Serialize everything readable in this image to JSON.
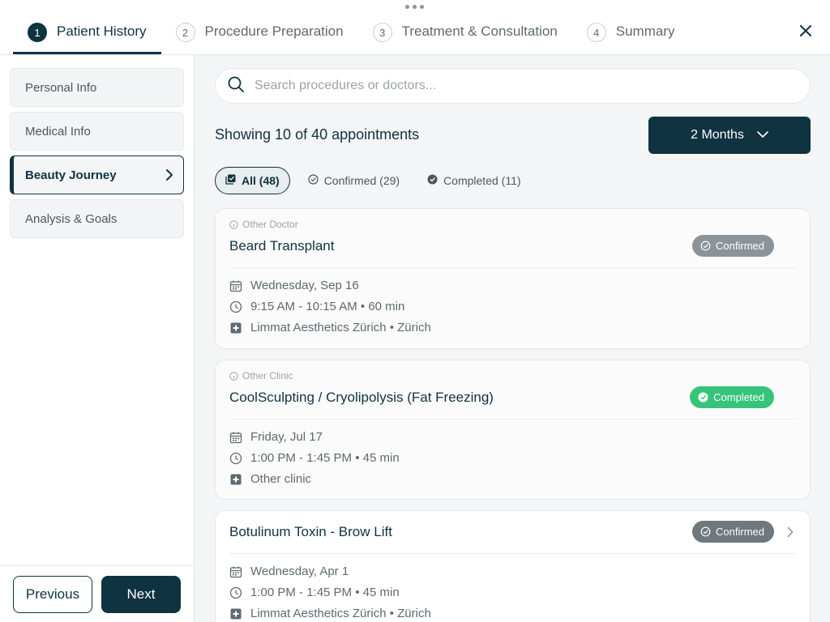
{
  "steps": [
    {
      "num": "1",
      "label": "Patient History"
    },
    {
      "num": "2",
      "label": "Procedure Preparation"
    },
    {
      "num": "3",
      "label": "Treatment & Consultation"
    },
    {
      "num": "4",
      "label": "Summary"
    }
  ],
  "sidebar": {
    "items": [
      {
        "label": "Personal Info"
      },
      {
        "label": "Medical Info"
      },
      {
        "label": "Beauty Journey"
      },
      {
        "label": "Analysis & Goals"
      }
    ],
    "previous_label": "Previous",
    "next_label": "Next"
  },
  "search": {
    "placeholder": "Search procedures or doctors...",
    "value": ""
  },
  "summary": {
    "showing": "Showing 10 of 40 appointments",
    "period": "2 Months"
  },
  "filters": [
    {
      "label": "All (48)"
    },
    {
      "label": "Confirmed (29)"
    },
    {
      "label": "Completed (11)"
    }
  ],
  "appointments": [
    {
      "source": "Other Doctor",
      "title": "Beard Transplant",
      "status": "Confirmed",
      "date": "Wednesday, Sep 16",
      "time": "9:15 AM - 10:15 AM • 60 min",
      "location": "Limmat Aesthetics Zürich • Zürich"
    },
    {
      "source": "Other Clinic",
      "title": "CoolSculpting / Cryolipolysis (Fat Freezing)",
      "status": "Completed",
      "date": "Friday, Jul 17",
      "time": "1:00 PM - 1:45 PM • 45 min",
      "location": "Other clinic"
    },
    {
      "source": "",
      "title": "Botulinum Toxin - Brow Lift",
      "status": "Confirmed",
      "date": "Wednesday, Apr 1",
      "time": "1:00 PM - 1:45 PM • 45 min",
      "location": "Limmat Aesthetics Zürich • Zürich"
    }
  ],
  "colors": {
    "primary": "#0f3340",
    "confirmed": "#8c9499",
    "completed": "#36c47b"
  }
}
